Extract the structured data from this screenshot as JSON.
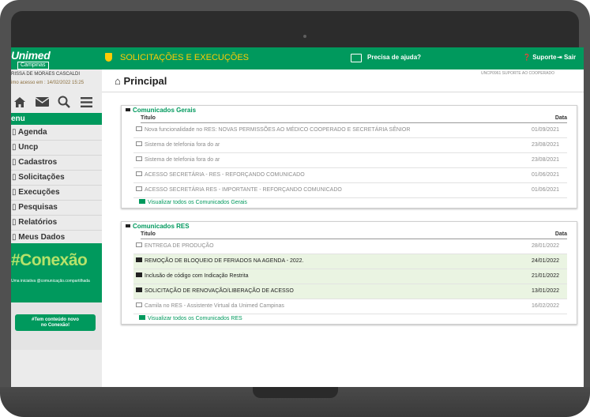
{
  "brand": {
    "name": "Unimed",
    "sub": "Campinas"
  },
  "topbar": {
    "title": "SOLICITAÇÕES E EXECUÇÕES",
    "help": "Precisa de ajuda?",
    "support": "Suporte",
    "exit": "Sair"
  },
  "user": {
    "name": "RISSA DE MORAES CASCALDI",
    "last_access": "imo acesso em : 14/02/2022 15:25"
  },
  "page": {
    "title": "Principal",
    "subtitle": "UNCP0961 SUPORTE AO COOPERADO"
  },
  "sidebar": {
    "icons": [
      "home-icon",
      "mail-icon",
      "search-icon",
      "menu-icon"
    ],
    "menu_label": "enu",
    "items": [
      {
        "label": "Agenda"
      },
      {
        "label": "Uncp"
      },
      {
        "label": "Cadastros"
      },
      {
        "label": "Solicitações"
      },
      {
        "label": "Execuções"
      },
      {
        "label": "Pesquisas"
      },
      {
        "label": "Relatórios"
      },
      {
        "label": "Meus Dados"
      }
    ],
    "banner": {
      "tag": "#Conexão",
      "small": "Uma iniciativa @comunicação.compartilhada",
      "button_line1": "#Tem conteúdo novo",
      "button_line2": "no Conexão!"
    }
  },
  "gerais": {
    "title": "Comunicados Gerais",
    "col_title": "Titulo",
    "col_date": "Data",
    "rows": [
      {
        "title": "Nova funcionalidade no RES: NOVAS PERMISSÕES AO MÉDICO COOPERADO E SECRETÁRIA SÊNIOR",
        "date": "01/09/2021"
      },
      {
        "title": "Sistema de telefonia fora do ar",
        "date": "23/08/2021"
      },
      {
        "title": "Sistema de telefonia fora do ar",
        "date": "23/08/2021"
      },
      {
        "title": "ACESSO SECRETÁRIA - RES - REFORÇANDO COMUNICADO",
        "date": "01/06/2021"
      },
      {
        "title": "ACESSO SECRETÁRIA RES - IMPORTANTE - REFORÇANDO COMUNICADO",
        "date": "01/06/2021"
      }
    ],
    "view_all": "Visualizar todos os Comunicados Gerais"
  },
  "res": {
    "title": "Comunicados RES",
    "col_title": "Titulo",
    "col_date": "Data",
    "rows": [
      {
        "title": "ENTREGA DE PRODUÇÃO",
        "date": "28/01/2022",
        "unread": false
      },
      {
        "title": "REMOÇÃO DE BLOQUEIO DE FERIADOS NA AGENDA - 2022.",
        "date": "24/01/2022",
        "unread": true
      },
      {
        "title": "Inclusão de código com Indicação Restrita",
        "date": "21/01/2022",
        "unread": true
      },
      {
        "title": "SOLICITAÇÃO DE RENOVAÇÃO/LIBERAÇÃO DE ACESSO",
        "date": "13/01/2022",
        "unread": true
      },
      {
        "title": "Camila no RES - Assistente Virtual da Unimed Campinas",
        "date": "16/02/2022",
        "unread": false
      }
    ],
    "view_all": "Visualizar todos os Comunicados RES"
  },
  "colors": {
    "brand_green": "#00995d",
    "accent_yellow": "#ffcb05",
    "highlight_row": "#eaf4e2"
  }
}
